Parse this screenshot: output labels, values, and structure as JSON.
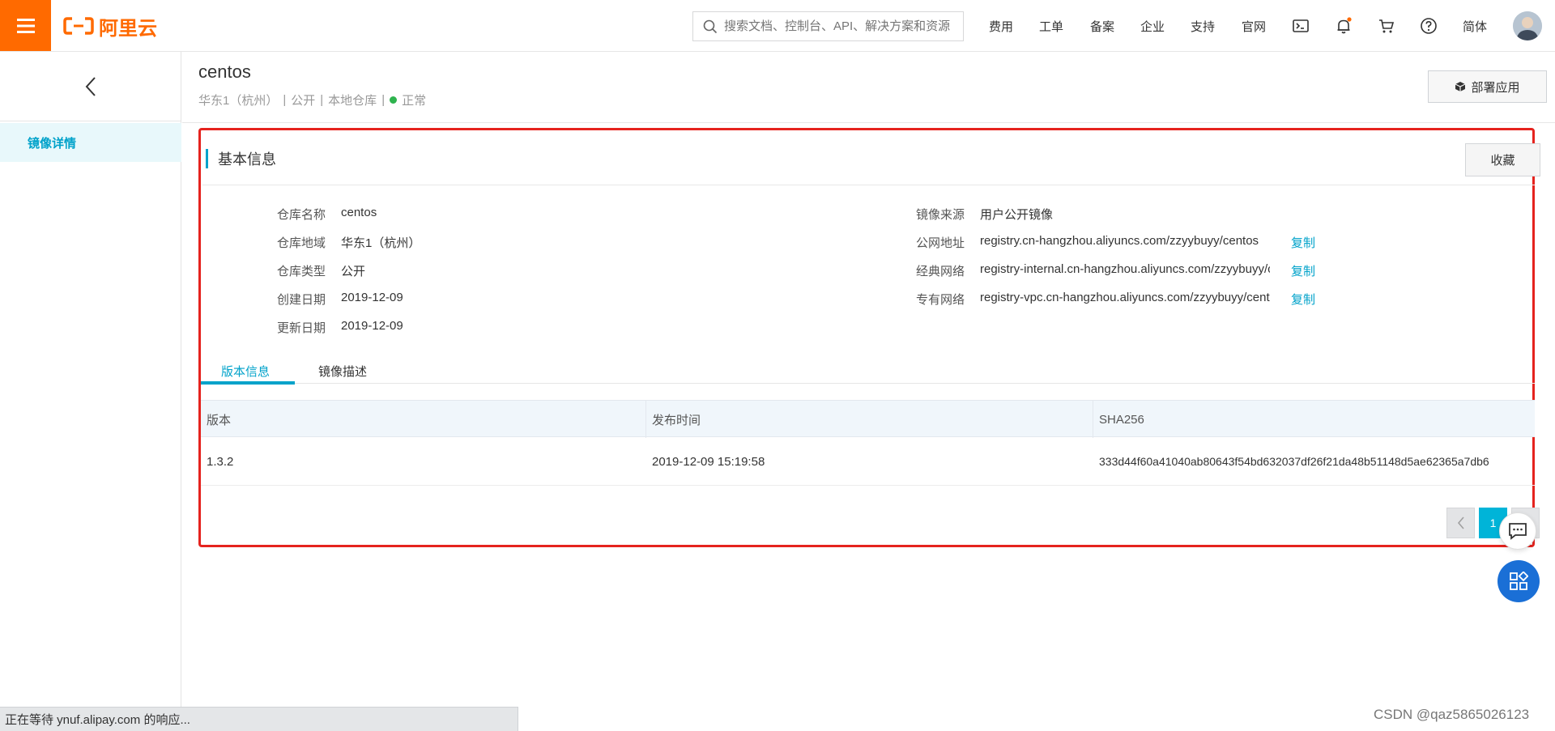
{
  "topbar": {
    "logo_text": "阿里云",
    "search_placeholder": "搜索文档、控制台、API、解决方案和资源",
    "nav": [
      "费用",
      "工单",
      "备案",
      "企业",
      "支持",
      "官网"
    ],
    "lang": "简体",
    "icons": [
      "terminal-icon",
      "bell-icon",
      "cart-icon",
      "help-icon"
    ],
    "brand_color": "#ff6a00"
  },
  "sidebar": {
    "items": [
      {
        "label": "镜像详情",
        "active": true
      }
    ]
  },
  "header": {
    "title": "centos",
    "region": "华东1（杭州）",
    "visibility": "公开",
    "repo_kind": "本地仓库",
    "status": "正常",
    "status_color": "#2eb34e",
    "deploy_label": "部署应用"
  },
  "basic_info": {
    "section_title": "基本信息",
    "fav_label": "收藏",
    "left": [
      {
        "label": "仓库名称",
        "value": "centos"
      },
      {
        "label": "仓库地域",
        "value": "华东1（杭州）"
      },
      {
        "label": "仓库类型",
        "value": "公开"
      },
      {
        "label": "创建日期",
        "value": "2019-12-09"
      },
      {
        "label": "更新日期",
        "value": "2019-12-09"
      }
    ],
    "right": [
      {
        "label": "镜像来源",
        "value": "用户公开镜像",
        "copy": ""
      },
      {
        "label": "公网地址",
        "value": "registry.cn-hangzhou.aliyuncs.com/zzyybuyy/centos",
        "copy": "复制"
      },
      {
        "label": "经典网络",
        "value": "registry-internal.cn-hangzhou.aliyuncs.com/zzyybuyy/c",
        "copy": "复制"
      },
      {
        "label": "专有网络",
        "value": "registry-vpc.cn-hangzhou.aliyuncs.com/zzyybuyy/cent",
        "copy": "复制"
      }
    ]
  },
  "tabs": [
    {
      "label": "版本信息",
      "active": true
    },
    {
      "label": "镜像描述",
      "active": false
    }
  ],
  "table": {
    "columns": [
      "版本",
      "发布时间",
      "SHA256"
    ],
    "rows": [
      [
        "1.3.2",
        "2019-12-09 15:19:58",
        "333d44f60a41040ab80643f54bd632037df26f21da48b51148d5ae62365a7db6"
      ]
    ]
  },
  "pagination": {
    "current_page": "1"
  },
  "statusbar": {
    "text": "正在等待 ynuf.alipay.com 的响应..."
  },
  "watermark": "CSDN @qaz5865026123",
  "accent_color": "#00a2ca"
}
